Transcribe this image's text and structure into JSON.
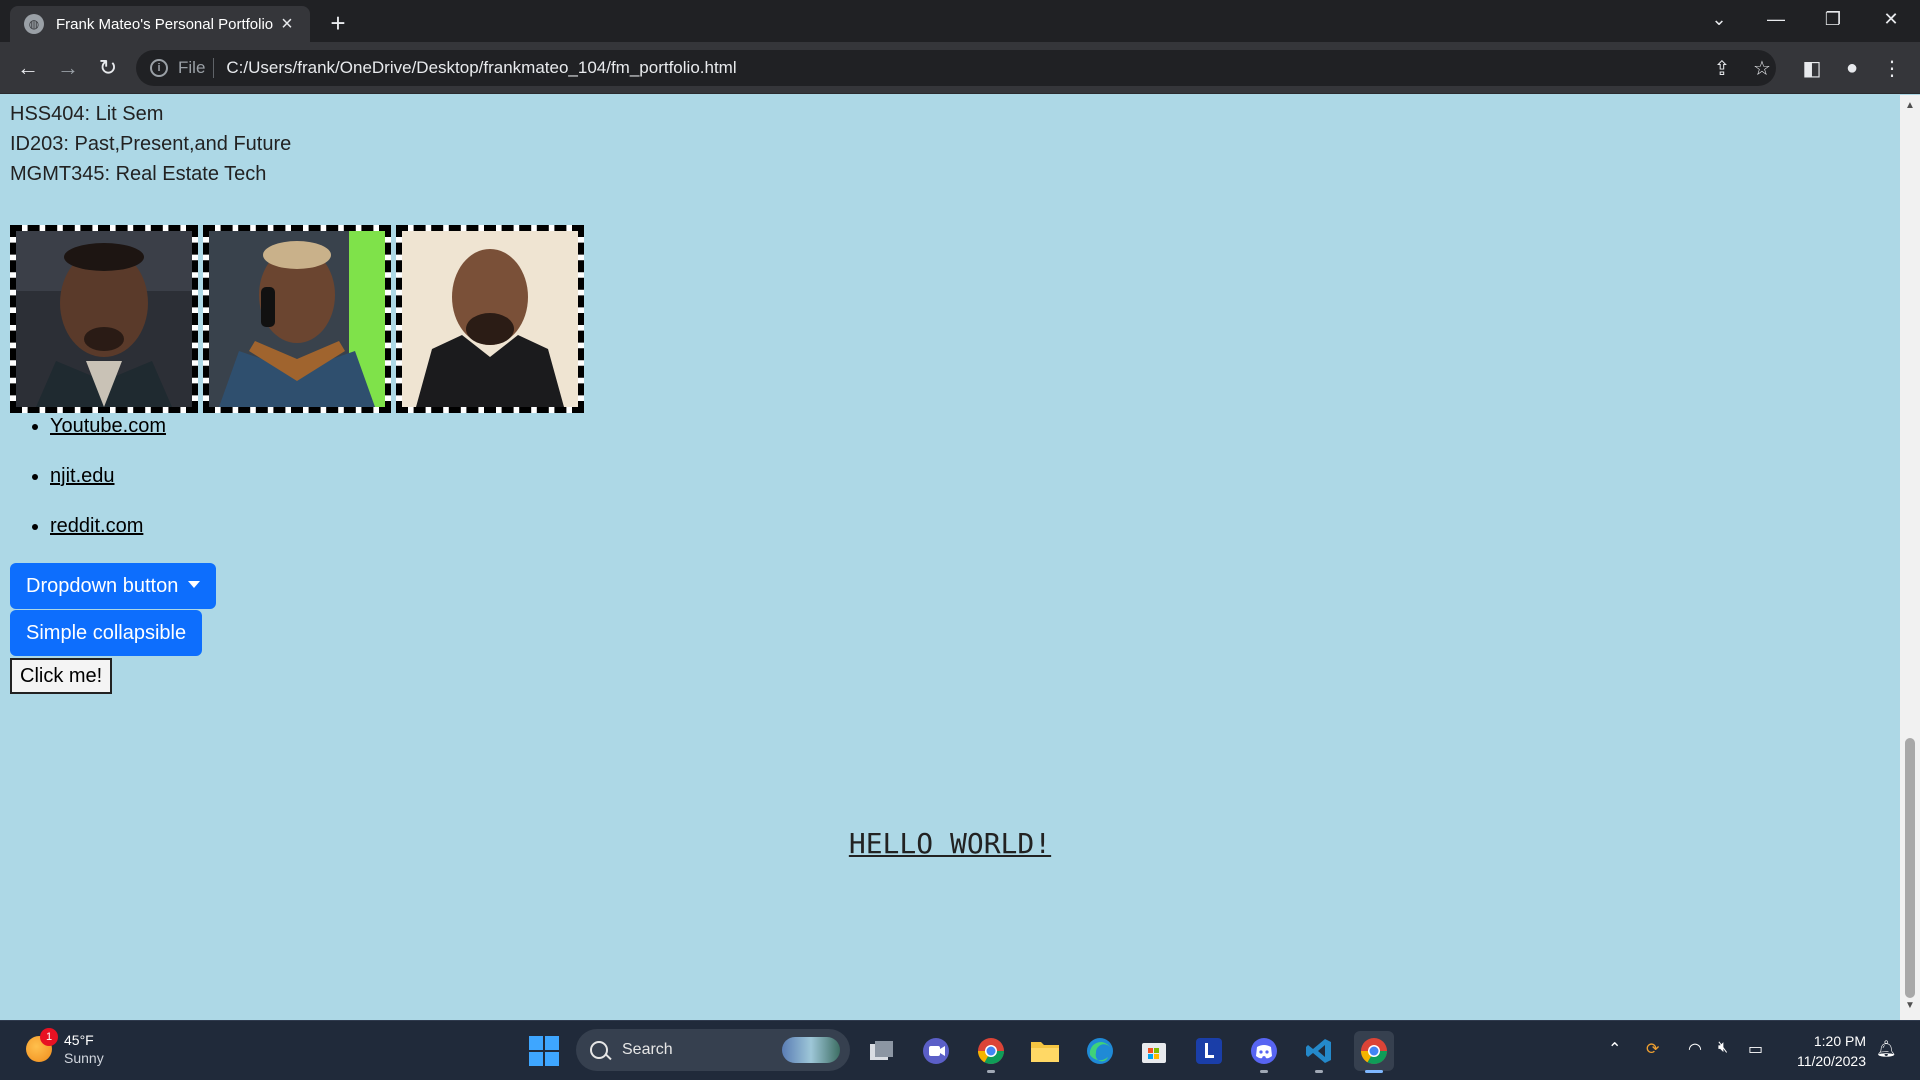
{
  "browser": {
    "tab_title": "Frank Mateo's Personal Portfolio",
    "address_scheme": "File",
    "address_url": "C:/Users/frank/OneDrive/Desktop/frankmateo_104/fm_portfolio.html"
  },
  "page": {
    "courses": [
      "HSS404: Lit Sem",
      "ID203: Past,Present,and Future",
      "MGMT345: Real Estate Tech"
    ],
    "links": [
      "Youtube.com",
      "njit.edu",
      "reddit.com"
    ],
    "dropdown_label": "Dropdown button",
    "collapsible_label": "Simple collapsible",
    "click_label": "Click me!",
    "hello": "HELLO WORLD!"
  },
  "taskbar": {
    "weather_temp": "45°F",
    "weather_desc": "Sunny",
    "weather_badge": "1",
    "search_label": "Search",
    "time": "1:20 PM",
    "date": "11/20/2023"
  },
  "colors": {
    "page_bg": "#add8e6",
    "button_primary": "#0d6efd"
  }
}
